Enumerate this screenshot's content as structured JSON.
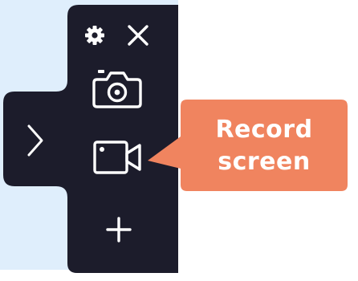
{
  "toolbar": {
    "settings_icon": "gear-icon",
    "close_icon": "close-icon",
    "screenshot_icon": "camera-icon",
    "record_icon": "video-camera-icon",
    "add_icon": "plus-icon",
    "expand_icon": "chevron-right-icon"
  },
  "tooltip": {
    "line1": "Record",
    "line2": "screen"
  },
  "colors": {
    "panel": "#1c1c2b",
    "icon": "#ffffff",
    "tooltip": "#f0845f",
    "screen_background": "#dfeefc"
  }
}
